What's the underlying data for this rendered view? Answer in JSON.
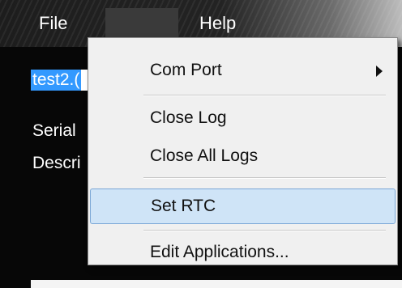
{
  "menubar": {
    "file_label": "File",
    "help_label": "Help"
  },
  "form": {
    "selected_text": "test2.(",
    "serial_label": "Serial",
    "description_label": "Descri"
  },
  "context_menu": {
    "items": [
      {
        "label": "Com Port",
        "submenu": true
      },
      {
        "label": "Close Log"
      },
      {
        "label": "Close All Logs"
      },
      {
        "label": "Set RTC",
        "highlighted": true
      },
      {
        "label": "Edit Applications..."
      }
    ]
  },
  "colors": {
    "highlight_bg": "#cfe4f7",
    "highlight_border": "#7ba7d6",
    "selection": "#3399ff",
    "menu_bg": "#f0f0f0"
  }
}
